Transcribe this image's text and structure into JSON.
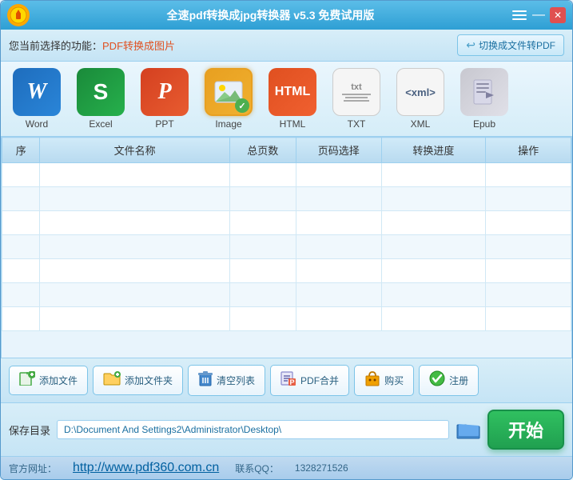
{
  "titleBar": {
    "title": "全速pdf转换成jpg转换器 v5.3 免费试用版",
    "logo": "●",
    "minBtn": "—",
    "closeBtn": "✕"
  },
  "toolbar": {
    "currentFuncLabel": "您当前选择的功能：",
    "currentFunc": "PDF转换成图片",
    "switchBtn": "切换成文件转PDF"
  },
  "formats": [
    {
      "id": "word",
      "label": "Word",
      "iconClass": "icon-word",
      "content": "W"
    },
    {
      "id": "excel",
      "label": "Excel",
      "iconClass": "icon-excel",
      "content": "S"
    },
    {
      "id": "ppt",
      "label": "PPT",
      "iconClass": "icon-ppt",
      "content": "P"
    },
    {
      "id": "image",
      "label": "Image",
      "iconClass": "icon-image",
      "content": "img",
      "selected": true
    },
    {
      "id": "html",
      "label": "HTML",
      "iconClass": "icon-html",
      "content": "HTML"
    },
    {
      "id": "txt",
      "label": "TXT",
      "iconClass": "icon-txt",
      "content": "txt"
    },
    {
      "id": "xml",
      "label": "XML",
      "iconClass": "icon-xml",
      "content": "xml>"
    },
    {
      "id": "epub",
      "label": "Epub",
      "iconClass": "icon-epub",
      "content": "ε"
    }
  ],
  "table": {
    "headers": [
      "序",
      "文件名称",
      "总页数",
      "页码选择",
      "转换进度",
      "操作"
    ],
    "colWidths": [
      "40",
      "200",
      "70",
      "90",
      "110",
      "90"
    ],
    "rows": []
  },
  "actions": [
    {
      "id": "add-file",
      "label": "添加文件",
      "icon": "📄"
    },
    {
      "id": "add-folder",
      "label": "添加文件夹",
      "icon": "📁"
    },
    {
      "id": "clear-list",
      "label": "清空列表",
      "icon": "🗑"
    },
    {
      "id": "pdf-merge",
      "label": "PDF合并",
      "icon": "📋"
    },
    {
      "id": "buy",
      "label": "购买",
      "icon": "🛍"
    },
    {
      "id": "register",
      "label": "注册",
      "icon": "✅"
    }
  ],
  "saveBar": {
    "label": "保存目录",
    "path": "D:\\Document And Settings2\\Administrator\\Desktop\\"
  },
  "startBtn": {
    "label": "开始"
  },
  "footer": {
    "website": {
      "label": "官方网址：",
      "url": "http://www.pdf360.com.cn"
    },
    "qq": {
      "label": "联系QQ：",
      "value": "1328271526"
    }
  }
}
